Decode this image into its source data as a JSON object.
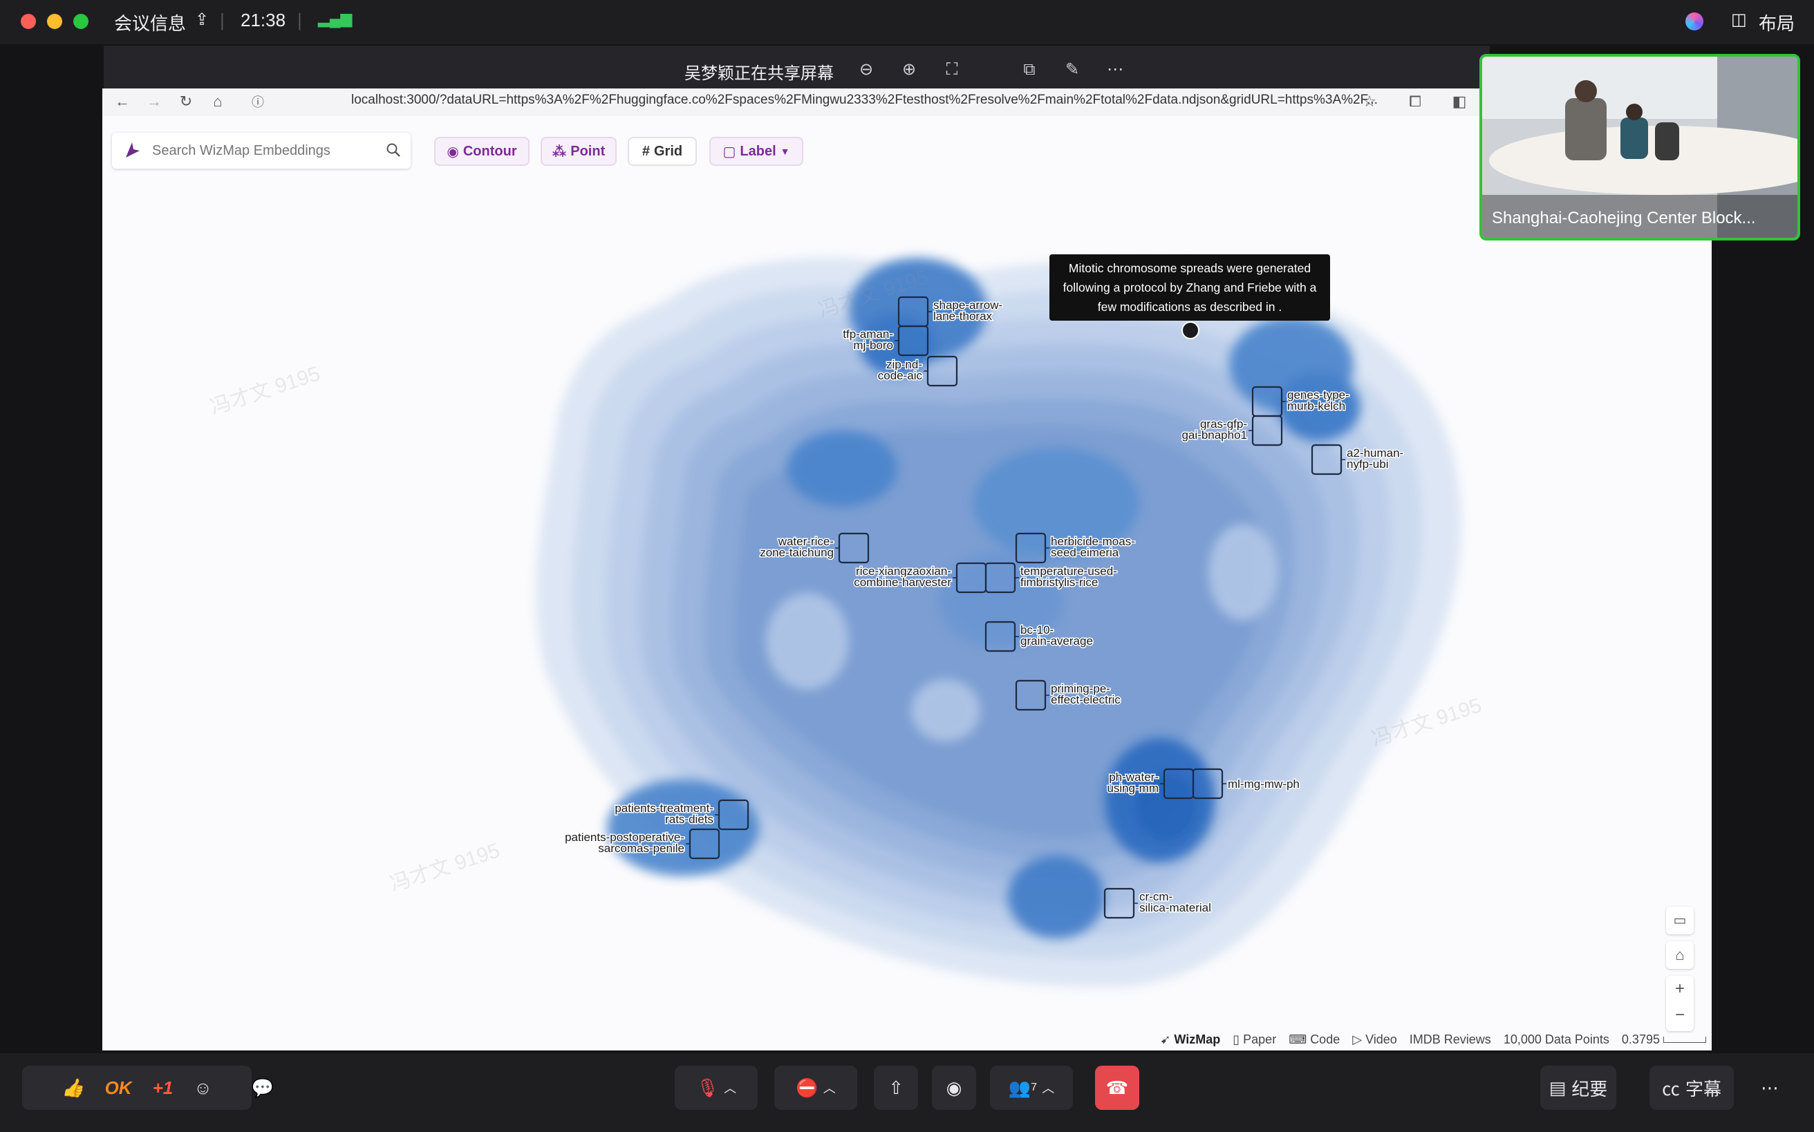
{
  "meeting": {
    "title": "会议信息",
    "time": "21:38",
    "layout_label": "布局",
    "share_banner": "吴梦颖正在共享屏幕",
    "participant_count": "7",
    "watermark": "冯才文 9195",
    "participant_video_caption": "Shanghai-Caohejing Center Block...",
    "reactions": {
      "ok": "OK",
      "plus_one": "+1"
    },
    "notes_label": "纪要",
    "captions_label": "字幕"
  },
  "browser": {
    "url": "localhost:3000/?dataURL=https%3A%2F%2Fhuggingface.co%2Fspaces%2FMingwu2333%2Ftesthost%2Fresolve%2Fmain%2Ftotal%2Fdata.ndjson&gridURL=https%3A%2F..."
  },
  "wizmap": {
    "search_placeholder": "Search WizMap Embeddings",
    "toolbar": {
      "contour": "Contour",
      "point": "Point",
      "grid": "Grid",
      "label": "Label"
    },
    "tooltip": "Mitotic chromosome spreads were generated following a protocol by Zhang and Friebe with a few modifications as described in .",
    "labels": [
      {
        "l1": "shape-arrow-",
        "l2": "lane-thorax"
      },
      {
        "l1": "tfp-aman-",
        "l2": "mj-boro"
      },
      {
        "l1": "zip-nd-",
        "l2": "code-aic"
      },
      {
        "l1": "genes-type-",
        "l2": "murb-kelch"
      },
      {
        "l1": "gras-gfp-",
        "l2": "gai-bnapho1"
      },
      {
        "l1": "a2-human-",
        "l2": "nyfp-ubi"
      },
      {
        "l1": "water-rice-",
        "l2": "zone-taichung"
      },
      {
        "l1": "herbicide-moas-",
        "l2": "seed-eimeria"
      },
      {
        "l1": "rice-xiangzaoxian-",
        "l2": "combine-harvester"
      },
      {
        "l1": "temperature-used-",
        "l2": "fimbristylis-rice"
      },
      {
        "l1": "bc-10-",
        "l2": "grain-average"
      },
      {
        "l1": "priming-pe-",
        "l2": "effect-electric"
      },
      {
        "l1": "ph-water-",
        "l2": "using-mm"
      },
      {
        "l1": "ml-mg-mw-ph",
        "l2": ""
      },
      {
        "l1": "patients-treatment-",
        "l2": "rats-diets"
      },
      {
        "l1": "patients-postoperative-",
        "l2": "sarcomas-penile"
      },
      {
        "l1": "cr-cm-",
        "l2": "silica-material"
      }
    ],
    "footer": {
      "brand": "WizMap",
      "paper": "Paper",
      "code": "Code",
      "video": "Video",
      "dataset": "IMDB Reviews",
      "points": "10,000 Data Points",
      "scale": "0.3795"
    }
  },
  "colors": {
    "accent": "#7e2a98",
    "contour_dark": "#2f6fc2",
    "end_call": "#e5484d",
    "active_speaker": "#33c23a"
  }
}
